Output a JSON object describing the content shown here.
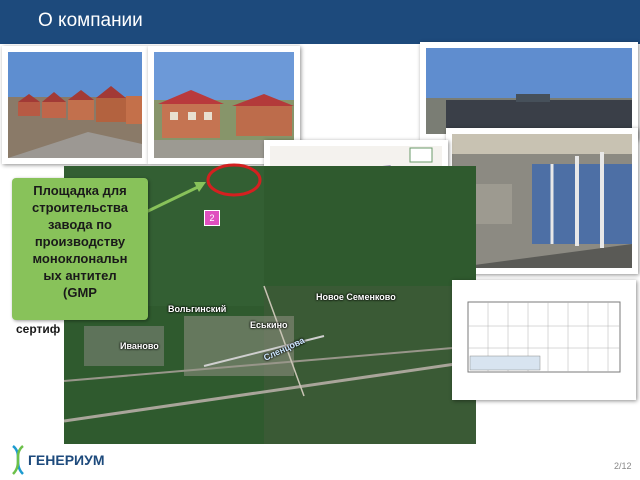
{
  "header": {
    "title": "О компании"
  },
  "photos": {
    "townhouses_row": "townhouses-row-photo",
    "townhouses_close": "townhouses-close-photo",
    "factory_exterior": "factory-exterior-photo",
    "factory_interior": "factory-interior-photo",
    "site_plan": "site-plan-drawing",
    "floor_plan": "floor-plan-drawing"
  },
  "map": {
    "marker": "2",
    "labels": {
      "novoe_semenkovo": "Новое Семенково",
      "volginsky": "Вольгинский",
      "eskino": "Еськино",
      "ivanovo": "Иваново",
      "road": "Сленцова"
    }
  },
  "callout": {
    "lines": [
      "Площадка для",
      "строительства",
      "завода по",
      "производству",
      "моноклональн",
      "ых антител",
      "(GMP"
    ],
    "overflow": "сертиф"
  },
  "footer": {
    "logo": "ГЕНЕРИУМ",
    "page": "2/12"
  },
  "colors": {
    "header": "#1d4a7c",
    "callout": "#88c25a",
    "circle": "#d42020"
  }
}
